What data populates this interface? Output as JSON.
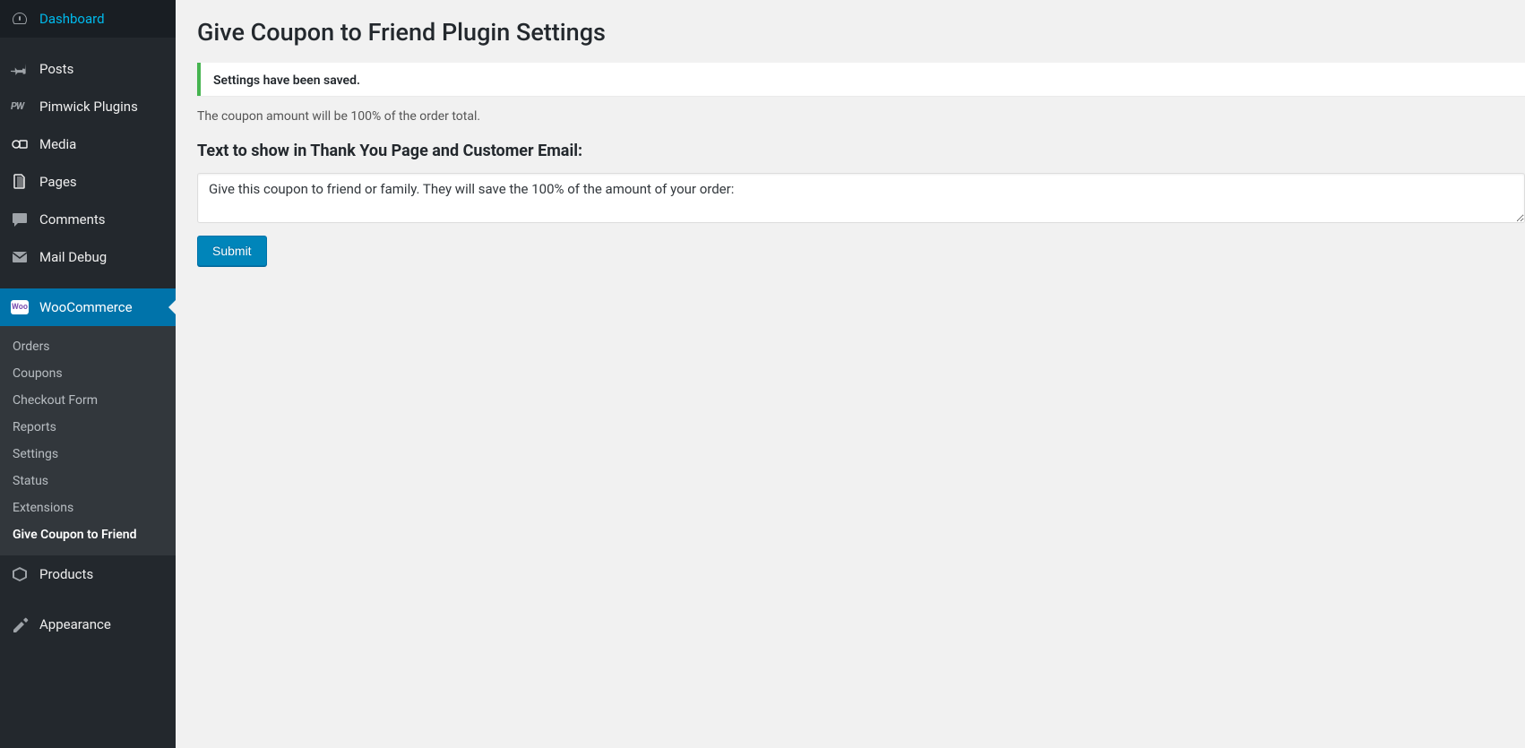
{
  "sidebar": {
    "items": [
      {
        "label": "Dashboard",
        "icon": "dashboard"
      },
      {
        "label": "Posts",
        "icon": "pin"
      },
      {
        "label": "Pimwick Plugins",
        "icon": "pw"
      },
      {
        "label": "Media",
        "icon": "media"
      },
      {
        "label": "Pages",
        "icon": "pages"
      },
      {
        "label": "Comments",
        "icon": "comments"
      },
      {
        "label": "Mail Debug",
        "icon": "mail"
      },
      {
        "label": "WooCommerce",
        "icon": "woo",
        "active": true
      },
      {
        "label": "Products",
        "icon": "products"
      },
      {
        "label": "Appearance",
        "icon": "appearance"
      }
    ],
    "submenu": [
      {
        "label": "Orders"
      },
      {
        "label": "Coupons"
      },
      {
        "label": "Checkout Form"
      },
      {
        "label": "Reports"
      },
      {
        "label": "Settings"
      },
      {
        "label": "Status"
      },
      {
        "label": "Extensions"
      },
      {
        "label": "Give Coupon to Friend",
        "current": true
      }
    ]
  },
  "main": {
    "title": "Give Coupon to Friend Plugin Settings",
    "notice": "Settings have been saved.",
    "description": "The coupon amount will be 100% of the order total.",
    "section_label": "Text to show in Thank You Page and Customer Email:",
    "textarea_value": "Give this coupon to friend or family. They will save the 100% of the amount of your order:",
    "submit_label": "Submit"
  }
}
